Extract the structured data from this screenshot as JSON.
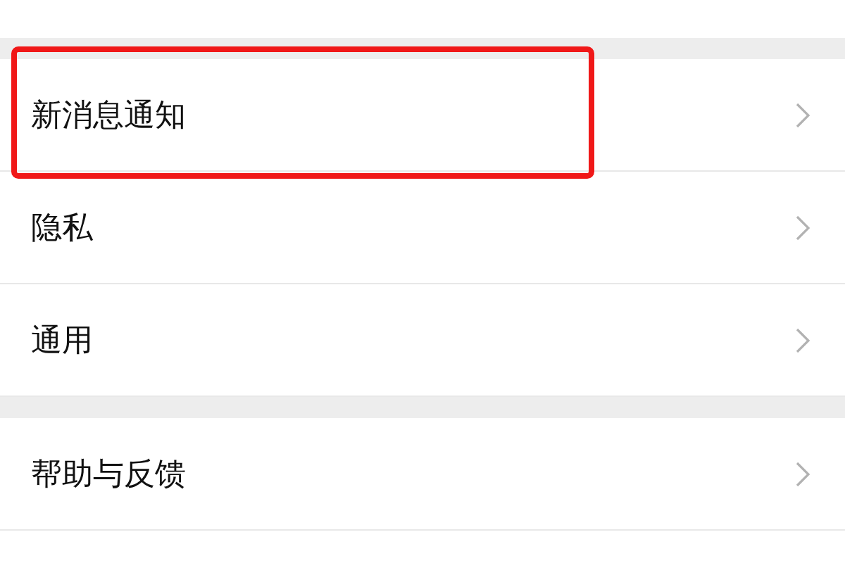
{
  "sections": [
    {
      "items": [
        {
          "label": "新消息通知",
          "highlighted": true
        },
        {
          "label": "隐私",
          "highlighted": false
        },
        {
          "label": "通用",
          "highlighted": false
        }
      ]
    },
    {
      "items": [
        {
          "label": "帮助与反馈",
          "highlighted": false
        }
      ]
    }
  ]
}
